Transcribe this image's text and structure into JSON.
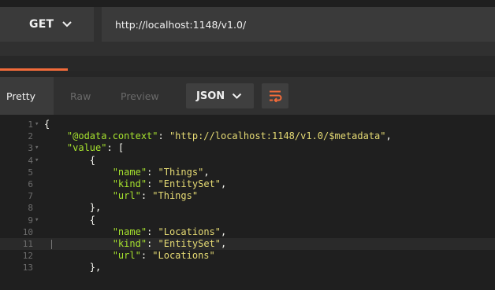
{
  "request": {
    "method": "GET",
    "url": "http://localhost:1148/v1.0/"
  },
  "response_toolbar": {
    "tabs": [
      "Pretty",
      "Raw",
      "Preview"
    ],
    "active_tab": "Pretty",
    "format": "JSON"
  },
  "icons": {
    "method_dropdown": "chevron-down-icon",
    "format_dropdown": "chevron-down-icon",
    "wrap": "wrap-lines-icon"
  },
  "colors": {
    "accent": "#f26b3a",
    "key": "#a6e22e",
    "string": "#e6db74",
    "punctuation": "#f8f8f2"
  },
  "code_lines": [
    {
      "n": "1",
      "fold": true,
      "indent": "",
      "key": "",
      "string": "",
      "text": "{"
    },
    {
      "n": "2",
      "fold": false,
      "indent": "    ",
      "key": "\"@odata.context\"",
      "string": "\"http://localhost:1148/v1.0/$metadata\"",
      "text": ","
    },
    {
      "n": "3",
      "fold": true,
      "indent": "    ",
      "key": "\"value\"",
      "string": "",
      "text": ": ["
    },
    {
      "n": "4",
      "fold": true,
      "indent": "        ",
      "key": "",
      "string": "",
      "text": "{"
    },
    {
      "n": "5",
      "fold": false,
      "indent": "            ",
      "key": "\"name\"",
      "string": "\"Things\"",
      "text": ","
    },
    {
      "n": "6",
      "fold": false,
      "indent": "            ",
      "key": "\"kind\"",
      "string": "\"EntitySet\"",
      "text": ","
    },
    {
      "n": "7",
      "fold": false,
      "indent": "            ",
      "key": "\"url\"",
      "string": "\"Things\"",
      "text": ""
    },
    {
      "n": "8",
      "fold": false,
      "indent": "        ",
      "key": "",
      "string": "",
      "text": "},"
    },
    {
      "n": "9",
      "fold": true,
      "indent": "        ",
      "key": "",
      "string": "",
      "text": "{"
    },
    {
      "n": "10",
      "fold": false,
      "indent": "            ",
      "key": "\"name\"",
      "string": "\"Locations\"",
      "text": ","
    },
    {
      "n": "11",
      "fold": false,
      "indent": "            ",
      "key": "\"kind\"",
      "string": "\"EntitySet\"",
      "text": ","
    },
    {
      "n": "12",
      "fold": false,
      "indent": "            ",
      "key": "\"url\"",
      "string": "\"Locations\"",
      "text": ""
    },
    {
      "n": "13",
      "fold": false,
      "indent": "        ",
      "key": "",
      "string": "",
      "text": "},"
    }
  ],
  "active_line": "11"
}
